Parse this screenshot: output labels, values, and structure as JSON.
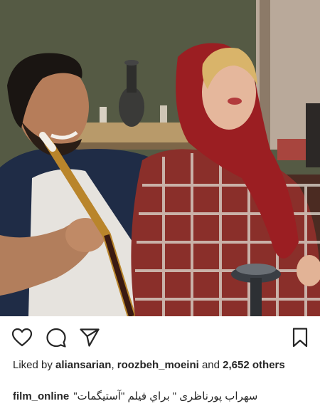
{
  "post": {
    "photo_alt_icon": "post-photo",
    "likes_prefix": "Liked by",
    "liker_1": "aliansarian",
    "liker_sep": ",",
    "liker_2": "roozbeh_moeini",
    "likes_and": "and",
    "likes_count": "2,652",
    "likes_others": "others",
    "caption_user": "film_online",
    "caption_text": "سهراب پورناظری \" براي فيلم \"آستيگمات\""
  },
  "actions": {
    "like_icon": "heart-icon",
    "comment_icon": "comment-icon",
    "share_icon": "send-icon",
    "save_icon": "bookmark-icon"
  },
  "colors": {
    "text": "#262626",
    "background": "#ffffff"
  }
}
